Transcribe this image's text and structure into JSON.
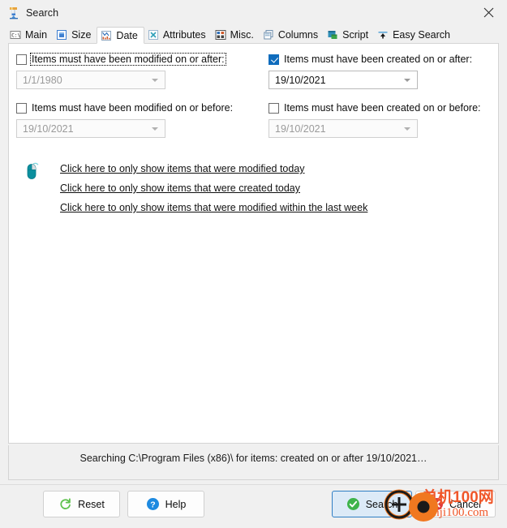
{
  "window": {
    "title": "Search",
    "icon": "everything-search-icon",
    "close_label": "×"
  },
  "tabs": [
    {
      "label": "Main",
      "icon": "console-icon",
      "active": false
    },
    {
      "label": "Size",
      "icon": "size-icon",
      "active": false
    },
    {
      "label": "Date",
      "icon": "date-chart-icon",
      "active": true
    },
    {
      "label": "Attributes",
      "icon": "attributes-icon",
      "active": false
    },
    {
      "label": "Misc.",
      "icon": "misc-icon",
      "active": false
    },
    {
      "label": "Columns",
      "icon": "columns-icon",
      "active": false
    },
    {
      "label": "Script",
      "icon": "script-icon",
      "active": false
    },
    {
      "label": "Easy Search",
      "icon": "easy-search-icon",
      "active": false
    }
  ],
  "date_panel": {
    "filters": [
      {
        "id": "modified-on-or-after",
        "checkbox_label": "Items must have been modified on or after:",
        "accesskey": "a",
        "checked": false,
        "focused": true,
        "date_value": "1/1/1980",
        "enabled": false
      },
      {
        "id": "created-on-or-after",
        "checkbox_label": "Items must have been created on or after:",
        "accesskey": "f",
        "checked": true,
        "focused": false,
        "date_value": "19/10/2021",
        "enabled": true
      },
      {
        "id": "modified-on-or-before",
        "checkbox_label": "Items must have been modified on or before:",
        "accesskey": "b",
        "checked": false,
        "focused": false,
        "date_value": "19/10/2021",
        "enabled": false
      },
      {
        "id": "created-on-or-before",
        "checkbox_label": "Items must have been created on or before:",
        "accesskey": "e",
        "checked": false,
        "focused": false,
        "date_value": "19/10/2021",
        "enabled": false
      }
    ],
    "shortcut_icon": "mouse-icon",
    "shortcut_links": [
      "Click here to only show items that were modified today",
      "Click here to only show items that were created today",
      "Click here to only show items that were modified within the last week"
    ]
  },
  "status": {
    "text": "Searching C:\\Program Files (x86)\\ for items: created on or after 19/10/2021…"
  },
  "buttons": [
    {
      "id": "reset",
      "label": "Reset",
      "icon": "refresh-icon",
      "default": false
    },
    {
      "id": "help",
      "label": "Help",
      "icon": "question-icon",
      "default": false
    },
    {
      "id": "search",
      "label": "Search",
      "icon": "check-icon",
      "default": true
    },
    {
      "id": "cancel",
      "label": "Cancel",
      "icon": "cancel-icon",
      "default": false
    }
  ],
  "watermark": {
    "chinese": "单机100网",
    "domain": "danji100.com"
  },
  "colors": {
    "accent": "#0f6cbd",
    "default_button_border": "#2f7ec4",
    "default_button_bg": "#dceaf7",
    "panel_bg": "#ffffff",
    "window_bg": "#f0f0f0",
    "mouse_icon": "#0b8f9e",
    "reset_icon": "#5fc24e",
    "help_icon": "#1e8ae0",
    "search_icon": "#3eb34b",
    "cancel_icon": "#e03b3b",
    "watermark": "#f0572a"
  }
}
